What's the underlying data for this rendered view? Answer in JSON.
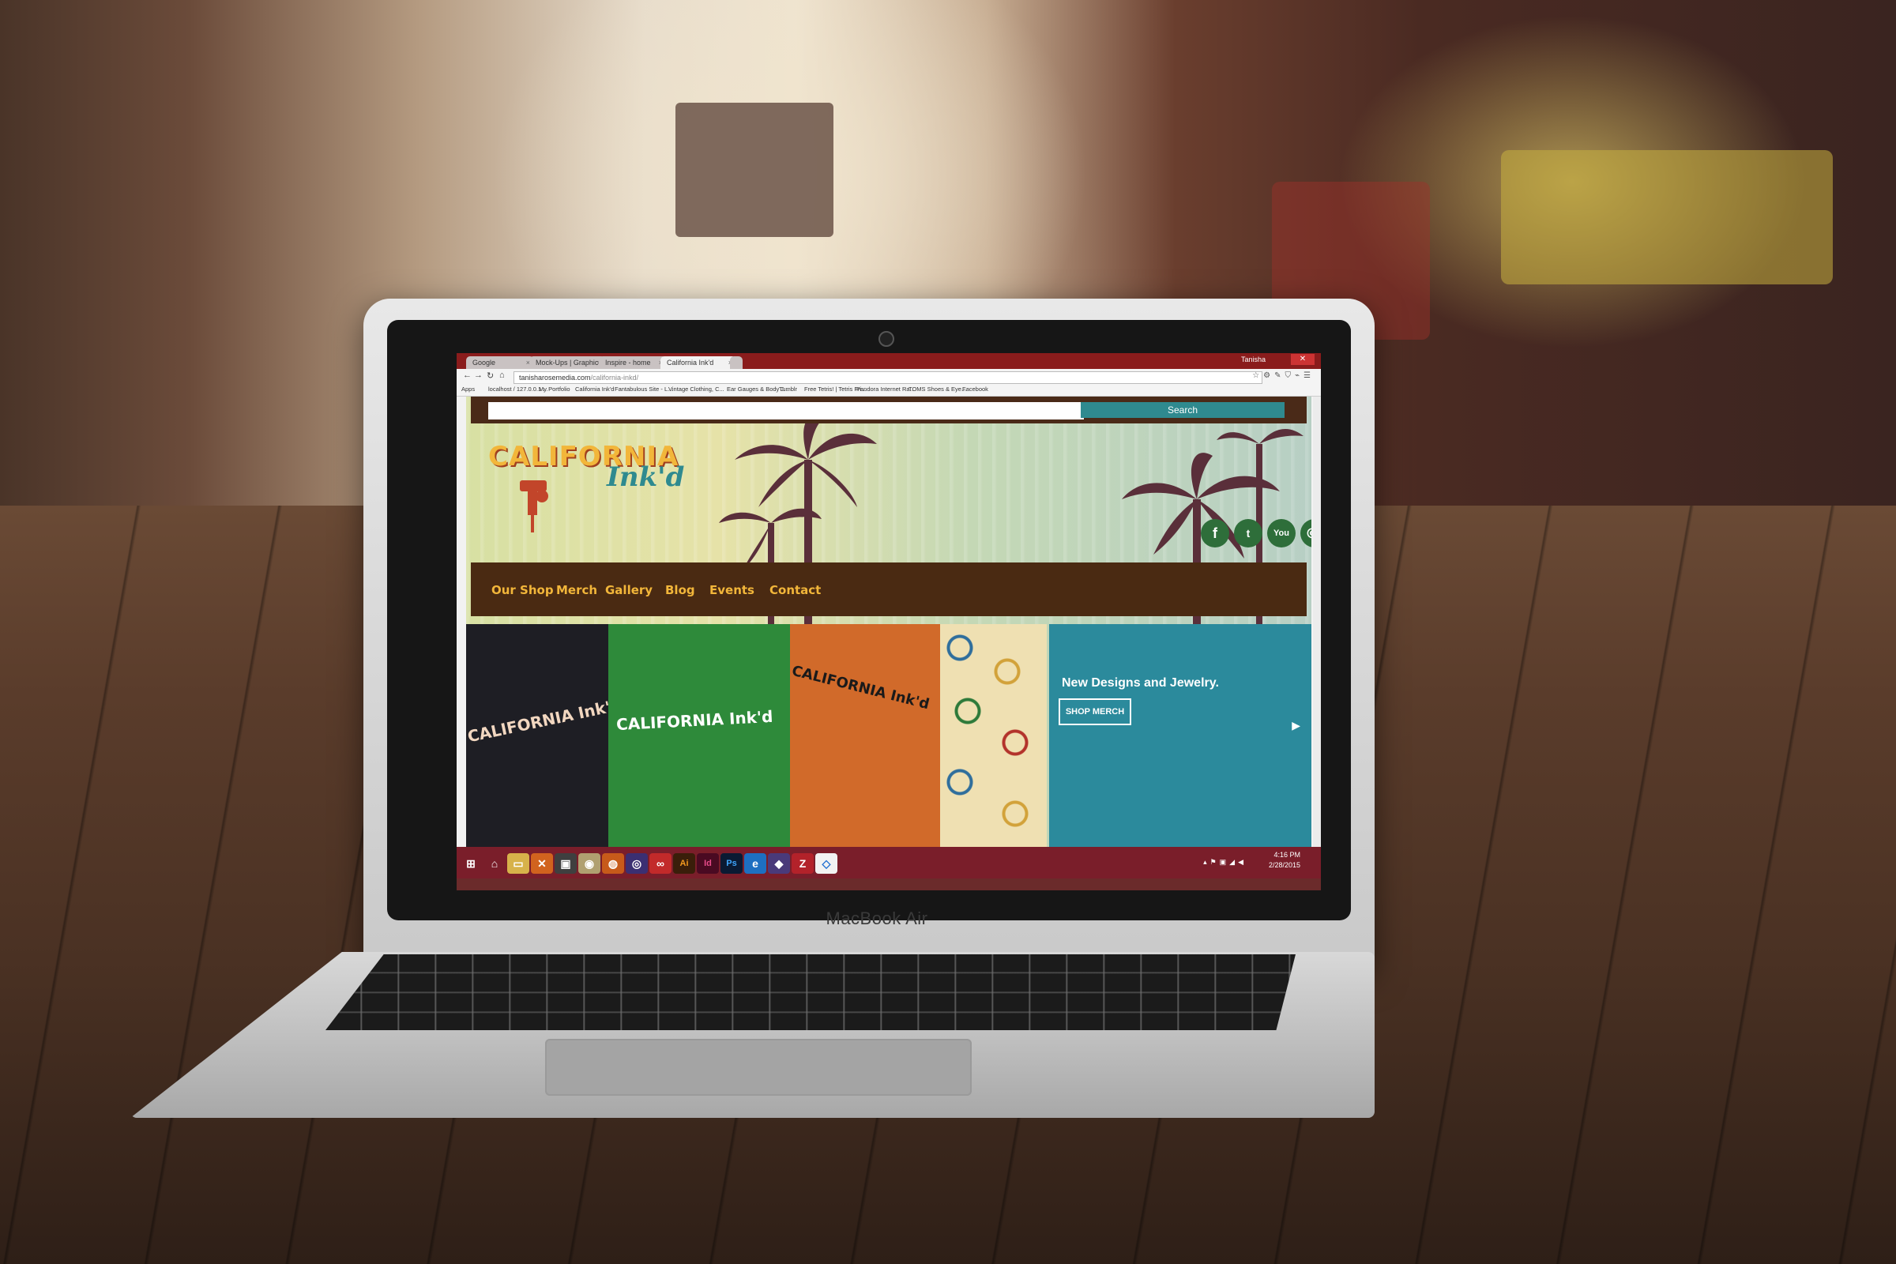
{
  "browser": {
    "tabs": [
      {
        "label": "Google"
      },
      {
        "label": "Mock-Ups | GraphicBurger"
      },
      {
        "label": "Inspire - home"
      },
      {
        "label": "California Ink'd"
      }
    ],
    "window_user": "Tanisha",
    "close_glyph": "✕",
    "address_domain": "tanisharosemedia.com",
    "address_path": "/california-inkd/",
    "bookmarks": [
      "Apps",
      "localhost / 127.0.0.1 ...",
      "My Portfolio",
      "California Ink'd",
      "Fantabulous Site - L...",
      "Vintage Clothing, C...",
      "Ear Gauges & Body J...",
      "Tumblr",
      "Free Tetris! | Tetris Fri...",
      "Pandora Internet Ra...",
      "TOMS Shoes & Eye...",
      "Facebook"
    ]
  },
  "site": {
    "search_button": "Search",
    "logo_line1": "CALIFORNIA",
    "logo_line2": "Ink'd",
    "social": {
      "facebook": "f",
      "twitter": "t",
      "youtube": "You",
      "instagram": "◎"
    },
    "nav": [
      "Our Shop",
      "Merch",
      "Gallery",
      "Blog",
      "Events",
      "Contact"
    ],
    "hero": {
      "shirt1_text": "CALIFORNIA Ink'd",
      "shirt2_text": "CALIFORNIA Ink'd",
      "shirt3_text": "CALIFORNIA Ink'd",
      "promo_title": "New Designs and Jewelry.",
      "promo_button": "SHOP MERCH",
      "promo_arrow": "▶"
    }
  },
  "laptop": {
    "brand": "MacBook Air"
  },
  "taskbar": {
    "clock_time": "4:16 PM",
    "clock_date": "2/28/2015",
    "apps": [
      "start",
      "home",
      "explorer",
      "xampp",
      "photos",
      "chrome",
      "firefox",
      "media",
      "creative-cloud",
      "Ai",
      "Id",
      "Ps",
      "internet-explorer",
      "app",
      "filezilla",
      "dropbox"
    ]
  }
}
